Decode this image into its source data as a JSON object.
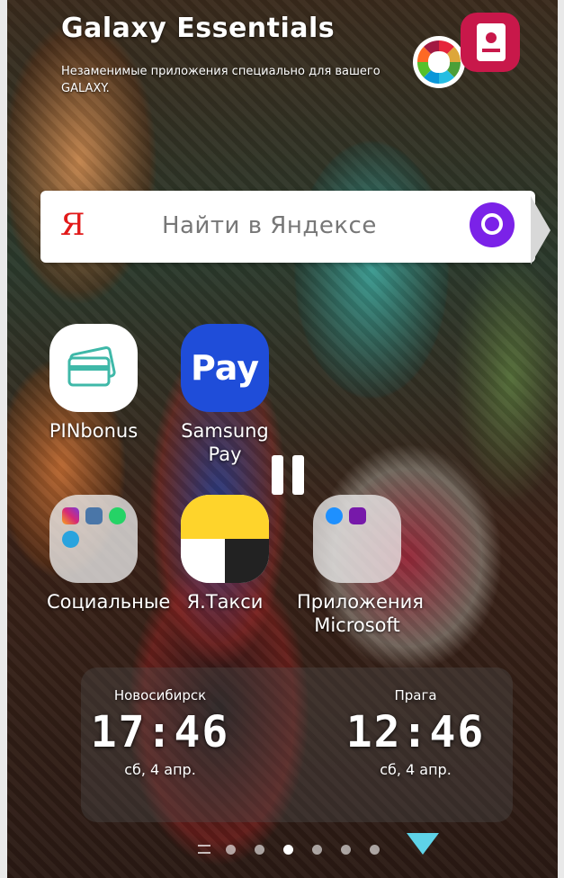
{
  "widget": {
    "title": "Galaxy Essentials",
    "subtitle": "Незаменимые приложения специально для вашего GALAXY."
  },
  "search": {
    "logo": "Я",
    "placeholder": "Найти в Яндексе",
    "assistant_icon": "alice-icon"
  },
  "apps": [
    {
      "label": "PINbonus",
      "icon": "pinbonus-card-icon"
    },
    {
      "label": "Samsung Pay",
      "icon": "pay-icon",
      "icon_text": "Pay"
    },
    {
      "label": "Социальные",
      "icon": "folder-icon"
    },
    {
      "label": "Я.Такси",
      "icon": "yandex-taxi-icon"
    },
    {
      "label": "Приложения Microsoft",
      "icon": "folder-icon"
    }
  ],
  "clocks": [
    {
      "city": "Новосибирск",
      "time": "17:46",
      "date": "сб, 4 апр."
    },
    {
      "city": "Прага",
      "time": "12:46",
      "date": "сб, 4 апр."
    }
  ],
  "colors": {
    "search_logo": "#e21a1a",
    "alice": "#7b22e8",
    "samsung_pay": "#1f4dd9",
    "taxi_yellow": "#fed42b",
    "drawer_arrow": "#5ed3e8"
  },
  "pager": {
    "pages": 6,
    "active_index": 2
  }
}
